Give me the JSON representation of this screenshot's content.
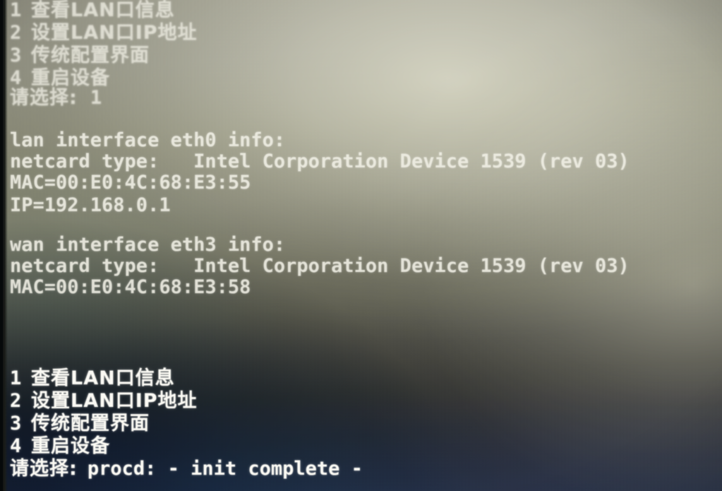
{
  "screen": {
    "type": "serial-console",
    "device_context": "router configuration menu",
    "colors": {
      "text": "#f2f1ea",
      "background_top": "#8a8a7b",
      "background_bottom": "#181a24",
      "bezel": "#0b0d0c"
    }
  },
  "top_menu": {
    "items": [
      {
        "number": "1",
        "label": "查看LAN口信息"
      },
      {
        "number": "2",
        "label": "设置LAN口IP地址"
      },
      {
        "number": "3",
        "label": "传统配置界面"
      },
      {
        "number": "4",
        "label": "重启设备"
      }
    ],
    "prompt_label": "请选择:",
    "prompt_value": "1"
  },
  "lan_info": {
    "header": "lan interface eth0 info:",
    "netcard_label": "netcard type:",
    "netcard_value": "Intel Corporation Device 1539 (rev 03)",
    "mac": "MAC=00:E0:4C:68:E3:55",
    "ip": "IP=192.168.0.1"
  },
  "wan_info": {
    "header": "wan interface eth3 info:",
    "netcard_label": "netcard type:",
    "netcard_value": "Intel Corporation Device 1539 (rev 03)",
    "mac": "MAC=00:E0:4C:68:E3:58"
  },
  "bottom_menu": {
    "items": [
      {
        "number": "1",
        "label": "查看LAN口信息"
      },
      {
        "number": "2",
        "label": "设置LAN口IP地址"
      },
      {
        "number": "3",
        "label": "传统配置界面"
      },
      {
        "number": "4",
        "label": "重启设备"
      }
    ],
    "prompt_label": "请选择:",
    "prompt_value": "procd: - init complete -"
  },
  "lines": {
    "lan_netcard_full": "netcard type:   Intel Corporation Device 1539 (rev 03)",
    "wan_netcard_full": "netcard type:   Intel Corporation Device 1539 (rev 03)"
  }
}
